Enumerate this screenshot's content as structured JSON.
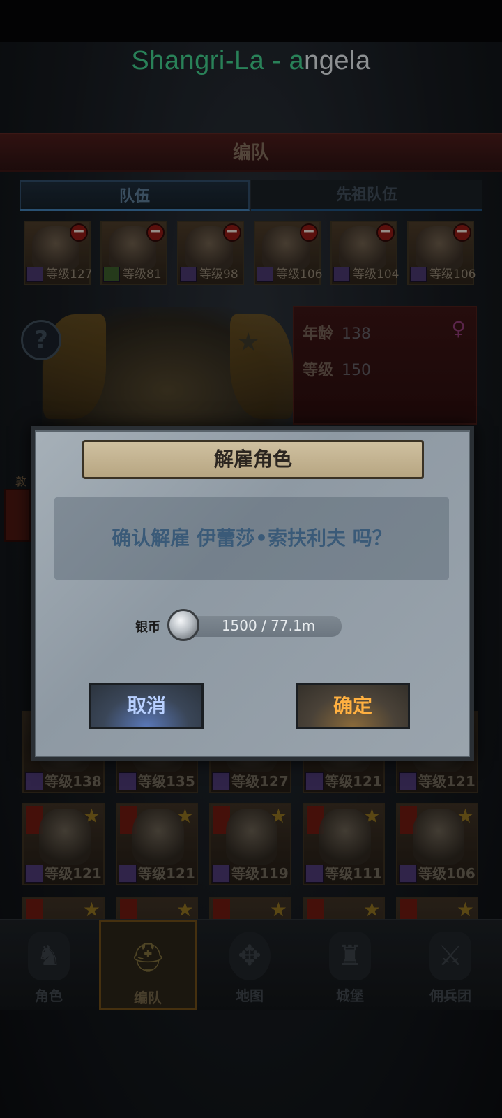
{
  "window": {
    "title_green_part": "Shangri-La - a",
    "title_white_part": "ngela"
  },
  "header": {
    "title": "编队"
  },
  "tabs": [
    {
      "label": "队伍"
    },
    {
      "label": "先祖队伍"
    }
  ],
  "team_slots": [
    {
      "level": "等级127"
    },
    {
      "level": "等级81"
    },
    {
      "level": "等级98"
    },
    {
      "level": "等级106"
    },
    {
      "level": "等级104"
    },
    {
      "level": "等级106"
    }
  ],
  "character_info": {
    "age_label": "年龄",
    "age_value": "138",
    "level_label": "等级",
    "level_value": "150",
    "gender_icon": "female-icon"
  },
  "side_badge": {
    "label": "敦"
  },
  "roster_rows": [
    [
      {
        "level": "等级138"
      },
      {
        "level": "等级135"
      },
      {
        "level": "等级127"
      },
      {
        "level": "等级121"
      },
      {
        "level": "等级121"
      }
    ],
    [
      {
        "level": "等级121"
      },
      {
        "level": "等级121"
      },
      {
        "level": "等级119"
      },
      {
        "level": "等级111"
      },
      {
        "level": "等级106"
      }
    ]
  ],
  "dialog": {
    "title": "解雇角色",
    "message": "确认解雇 伊蕾莎•索扶利夫 吗？",
    "cost_label": "银币",
    "cost_value": "1500 / 77.1m",
    "cancel_label": "取消",
    "confirm_label": "确定"
  },
  "bottom_nav": [
    {
      "label": "角色",
      "icon": "knight-icon"
    },
    {
      "label": "编队",
      "icon": "helmet-icon"
    },
    {
      "label": "地图",
      "icon": "compass-icon"
    },
    {
      "label": "城堡",
      "icon": "castle-icon"
    },
    {
      "label": "佣兵团",
      "icon": "mercenary-icon"
    }
  ]
}
